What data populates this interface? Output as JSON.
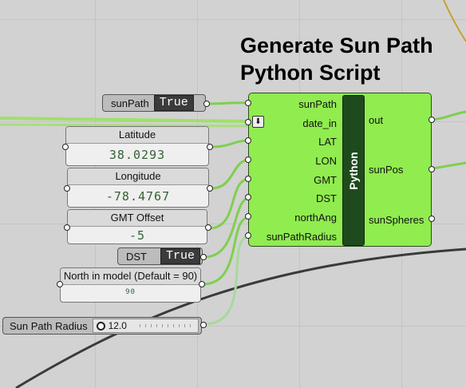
{
  "title_lines": [
    "Generate Sun Path",
    "Python Script"
  ],
  "toggles": {
    "sunpath": {
      "label": "sunPath",
      "value": "True"
    },
    "dst": {
      "label": "DST",
      "value": "True"
    }
  },
  "panels": {
    "latitude": {
      "label": "Latitude",
      "value": "38.0293"
    },
    "longitude": {
      "label": "Longitude",
      "value": "-78.4767"
    },
    "gmt_offset": {
      "label": "GMT Offset",
      "value": "-5"
    },
    "north": {
      "label": "North in model (Default = 90)",
      "value": "90"
    }
  },
  "slider": {
    "label": "Sun Path Radius",
    "value": "12.0"
  },
  "component": {
    "core_label": "Python",
    "inputs": [
      "sunPath",
      "date_in",
      "LAT",
      "LON",
      "GMT",
      "DST",
      "northAng",
      "sunPathRadius"
    ],
    "outputs": [
      "out",
      "sunPos",
      "sunSpheres"
    ],
    "date_icon": "download-arrow-icon"
  },
  "colors": {
    "canvas": "#d2d2d2",
    "component_fill": "#90ec4f",
    "wire": "#8fd85a",
    "value_text": "#355f35"
  }
}
